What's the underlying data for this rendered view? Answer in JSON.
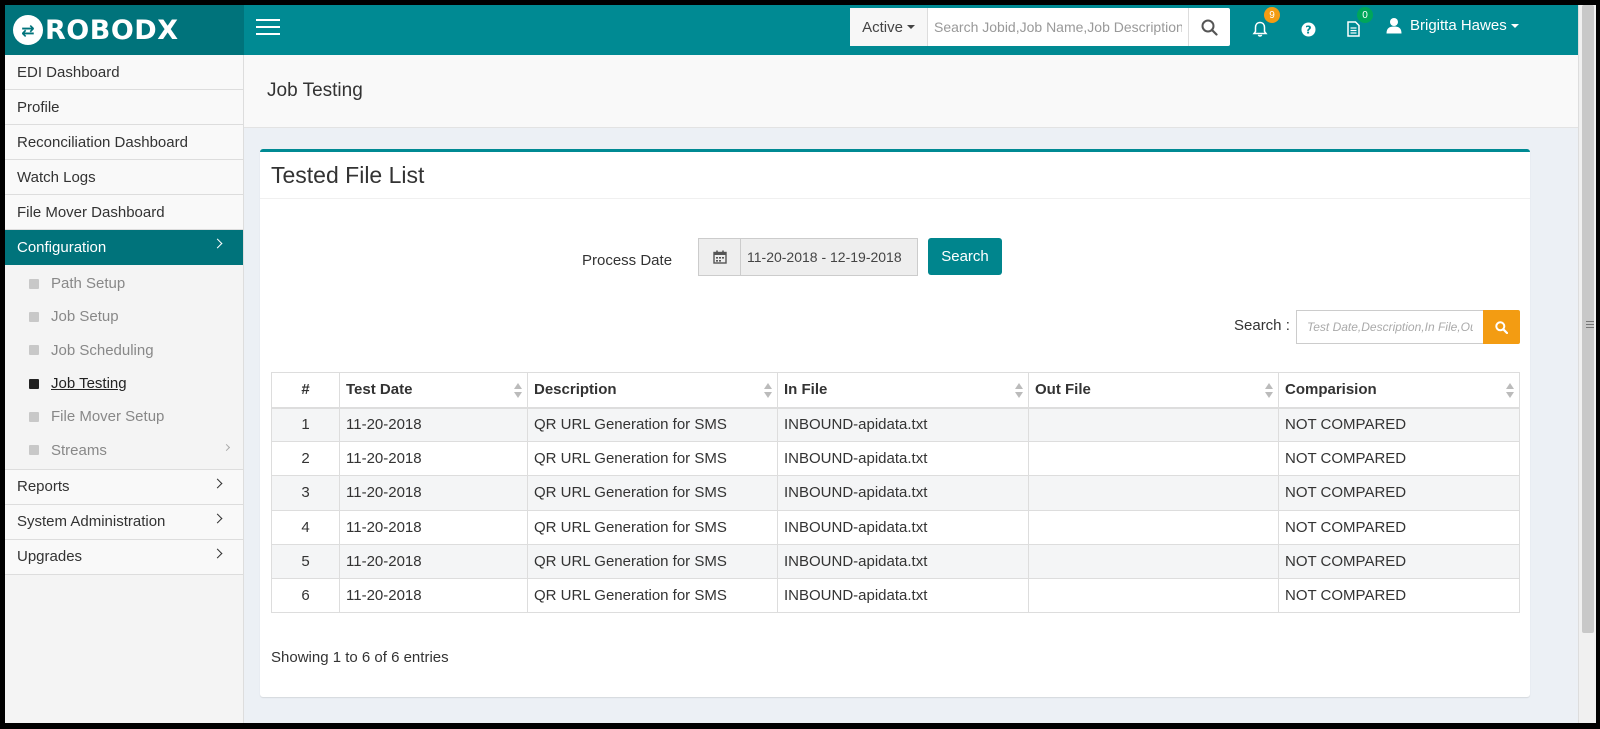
{
  "brand": {
    "logo_mark": "⇄",
    "name": "ROBODX"
  },
  "header": {
    "status_select": "Active",
    "search_placeholder": "Search Jobid,Job Name,Job Description,Job",
    "notifications_count": "9",
    "tasks_count": "0",
    "user_name": "Brigitta Hawes",
    "colors": {
      "topbar": "#008a93",
      "logo_bg": "#00737b",
      "notif_badge": "#f39c12",
      "task_badge": "#00a65a"
    }
  },
  "sidebar": {
    "items_top": [
      {
        "label": "EDI Dashboard"
      },
      {
        "label": "Profile"
      },
      {
        "label": "Reconciliation Dashboard"
      },
      {
        "label": "Watch Logs"
      },
      {
        "label": "File Mover Dashboard"
      }
    ],
    "configuration": {
      "label": "Configuration",
      "subitems": [
        {
          "label": "Path Setup"
        },
        {
          "label": "Job Setup"
        },
        {
          "label": "Job Scheduling"
        },
        {
          "label": "Job Testing"
        },
        {
          "label": "File Mover Setup"
        },
        {
          "label": "Streams"
        }
      ]
    },
    "items_bottom": [
      {
        "label": "Reports"
      },
      {
        "label": "System Administration"
      },
      {
        "label": "Upgrades"
      }
    ]
  },
  "page": {
    "title": "Job Testing"
  },
  "panel": {
    "title": "Tested File List",
    "process_date_label": "Process Date",
    "date_range": "11-20-2018 - 12-19-2018",
    "search_button": "Search",
    "table_search_label": "Search :",
    "table_search_placeholder": "Test Date,Description,In File,Out File",
    "columns": [
      "#",
      "Test Date",
      "Description",
      "In File",
      "Out File",
      "Comparision"
    ],
    "rows": [
      {
        "num": "1",
        "test_date": "11-20-2018",
        "description": "QR URL Generation for SMS",
        "in_file": "INBOUND-apidata.txt",
        "out_file": "",
        "comparison": "NOT COMPARED"
      },
      {
        "num": "2",
        "test_date": "11-20-2018",
        "description": "QR URL Generation for SMS",
        "in_file": "INBOUND-apidata.txt",
        "out_file": "",
        "comparison": "NOT COMPARED"
      },
      {
        "num": "3",
        "test_date": "11-20-2018",
        "description": "QR URL Generation for SMS",
        "in_file": "INBOUND-apidata.txt",
        "out_file": "",
        "comparison": "NOT COMPARED"
      },
      {
        "num": "4",
        "test_date": "11-20-2018",
        "description": "QR URL Generation for SMS",
        "in_file": "INBOUND-apidata.txt",
        "out_file": "",
        "comparison": "NOT COMPARED"
      },
      {
        "num": "5",
        "test_date": "11-20-2018",
        "description": "QR URL Generation for SMS",
        "in_file": "INBOUND-apidata.txt",
        "out_file": "",
        "comparison": "NOT COMPARED"
      },
      {
        "num": "6",
        "test_date": "11-20-2018",
        "description": "QR URL Generation for SMS",
        "in_file": "INBOUND-apidata.txt",
        "out_file": "",
        "comparison": "NOT COMPARED"
      }
    ],
    "entries_info": "Showing 1 to 6 of 6 entries"
  }
}
